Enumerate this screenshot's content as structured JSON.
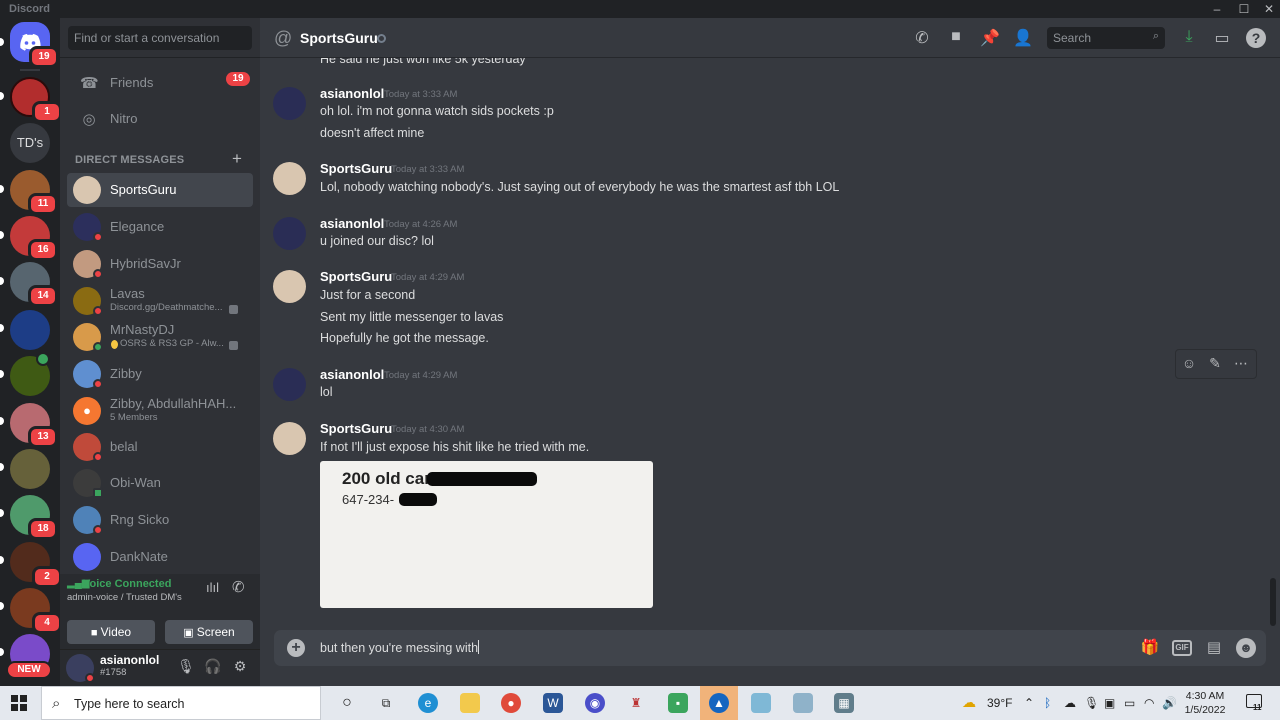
{
  "window": {
    "app_title": "Discord",
    "controls": [
      "–",
      "☐",
      "✕"
    ]
  },
  "rail": {
    "home_badge": "19",
    "servers": [
      {
        "label": "",
        "badge": "1",
        "color": "#b22d2d"
      },
      {
        "label": "TD's",
        "badge": "",
        "color": "#36393f"
      },
      {
        "label": "",
        "badge": "11",
        "color": "#9a5b2e"
      },
      {
        "label": "",
        "badge": "16",
        "color": "#c33a3a"
      },
      {
        "label": "",
        "badge": "14",
        "color": "#57656f"
      },
      {
        "label": "",
        "badge": "",
        "color": "#1d3d86"
      },
      {
        "label": "",
        "badge": "",
        "color": "#3f5a14"
      },
      {
        "label": "",
        "badge": "13",
        "color": "#b86a70"
      },
      {
        "label": "",
        "badge": "",
        "color": "#66613a"
      },
      {
        "label": "",
        "badge": "18",
        "color": "#4f9a6b"
      },
      {
        "label": "",
        "badge": "2",
        "color": "#522b1c"
      },
      {
        "label": "",
        "badge": "4",
        "color": "#7a3a1f"
      },
      {
        "label": "",
        "badge": "NEW",
        "color": "#7a4bc9"
      }
    ]
  },
  "sidebar": {
    "search_placeholder": "Find or start a conversation",
    "friends": {
      "label": "Friends",
      "badge": "19"
    },
    "nitro": {
      "label": "Nitro"
    },
    "dm_header": "DIRECT MESSAGES",
    "dms": [
      {
        "name": "SportsGuru",
        "sub": "",
        "color": "#d9c6b0",
        "status": "none",
        "active": true
      },
      {
        "name": "Elegance",
        "sub": "",
        "color": "#2c2f5c",
        "status": "dnd"
      },
      {
        "name": "HybridSavJr",
        "sub": "",
        "color": "#c29a80",
        "status": "dnd"
      },
      {
        "name": "Lavas",
        "sub": "Discord.gg/Deathmatche...",
        "color": "#8a6b12",
        "status": "dnd"
      },
      {
        "name": "MrNastyDJ",
        "sub": "OSRS & RS3 GP - Alw...",
        "color": "#d89a4a",
        "status": "online"
      },
      {
        "name": "Zibby",
        "sub": "",
        "color": "#5f8fd0",
        "status": "dnd"
      },
      {
        "name": "Zibby, AbdullahHAH...",
        "sub": "5 Members",
        "color": "#f57731",
        "status": "none"
      },
      {
        "name": "belal",
        "sub": "",
        "color": "#c04a3a",
        "status": "dnd"
      },
      {
        "name": "Obi-Wan",
        "sub": "",
        "color": "#3c3c3c",
        "status": "online"
      },
      {
        "name": "Rng Sicko",
        "sub": "",
        "color": "#4f82b8",
        "status": "dnd"
      },
      {
        "name": "DankNate",
        "sub": "",
        "color": "#5865f2",
        "status": "none"
      }
    ],
    "voice": {
      "status": "Voice Connected",
      "channel": "admin-voice / Trusted DM's",
      "video_label": "Video",
      "screen_label": "Screen"
    },
    "user": {
      "name": "asianonlol",
      "tag": "#1758"
    }
  },
  "chat": {
    "recipient": "SportsGuru",
    "search_placeholder": "Search",
    "partial_line": "He said he just won like 5k yesterday",
    "messages": [
      {
        "author": "asianonlol",
        "time": "Today at 3:33 AM",
        "lines": [
          "oh lol. i'm not gonna watch sids pockets :p",
          "doesn't affect mine"
        ]
      },
      {
        "author": "SportsGuru",
        "time": "Today at 3:33 AM",
        "lines": [
          "Lol, nobody watching nobody's. Just saying out of everybody he was the smartest asf tbh LOL"
        ]
      },
      {
        "author": "asianonlol",
        "time": "Today at 4:26 AM",
        "lines": [
          "u joined our disc? lol"
        ]
      },
      {
        "author": "SportsGuru",
        "time": "Today at 4:29 AM",
        "lines": [
          "Just for a second",
          "Sent my little messenger to lavas",
          "Hopefully he got the message."
        ]
      },
      {
        "author": "asianonlol",
        "time": "Today at 4:29 AM",
        "lines": [
          "lol"
        ]
      },
      {
        "author": "SportsGuru",
        "time": "Today at 4:30 AM",
        "lines": [
          "If not I'll just expose his shit like he tried with me."
        ]
      }
    ],
    "attachment": {
      "line1": "200 old car",
      "line2": "647-234-"
    },
    "composer_text": "but then you're messing with"
  },
  "taskbar": {
    "search_text": "Type here to search",
    "weather": "39°F",
    "time": "4:30 AM",
    "date": "1/5/2022",
    "notif_count": "11"
  }
}
